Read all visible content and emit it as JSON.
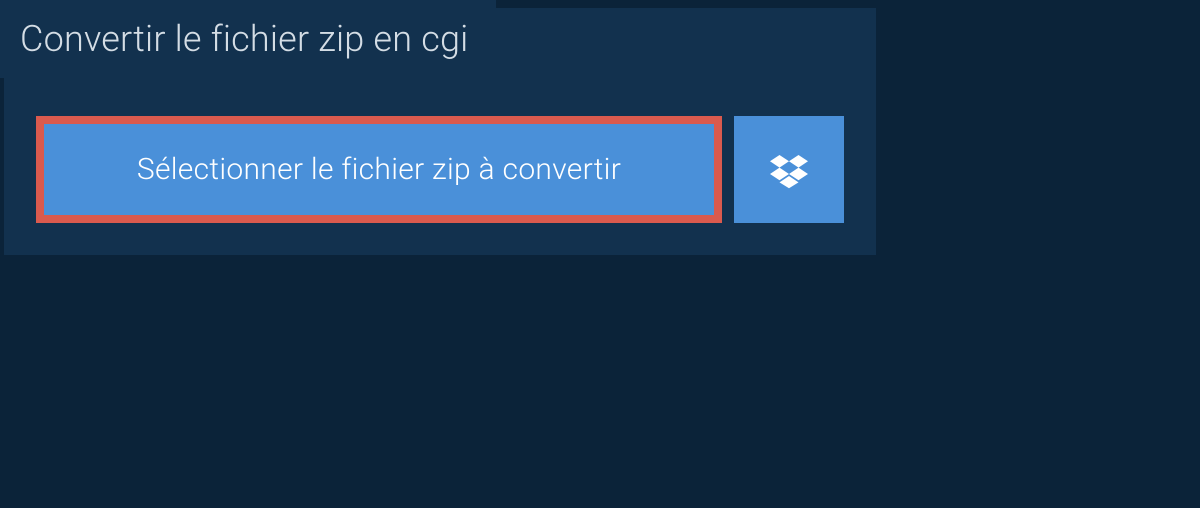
{
  "title": "Convertir le fichier zip en cgi",
  "select_button_label": "Sélectionner le fichier zip à convertir",
  "colors": {
    "background": "#0b2339",
    "card": "#12314e",
    "button": "#4a90d9",
    "highlight_border": "#da5a4e",
    "text_light": "#d4dde5",
    "text_white": "#ffffff"
  }
}
